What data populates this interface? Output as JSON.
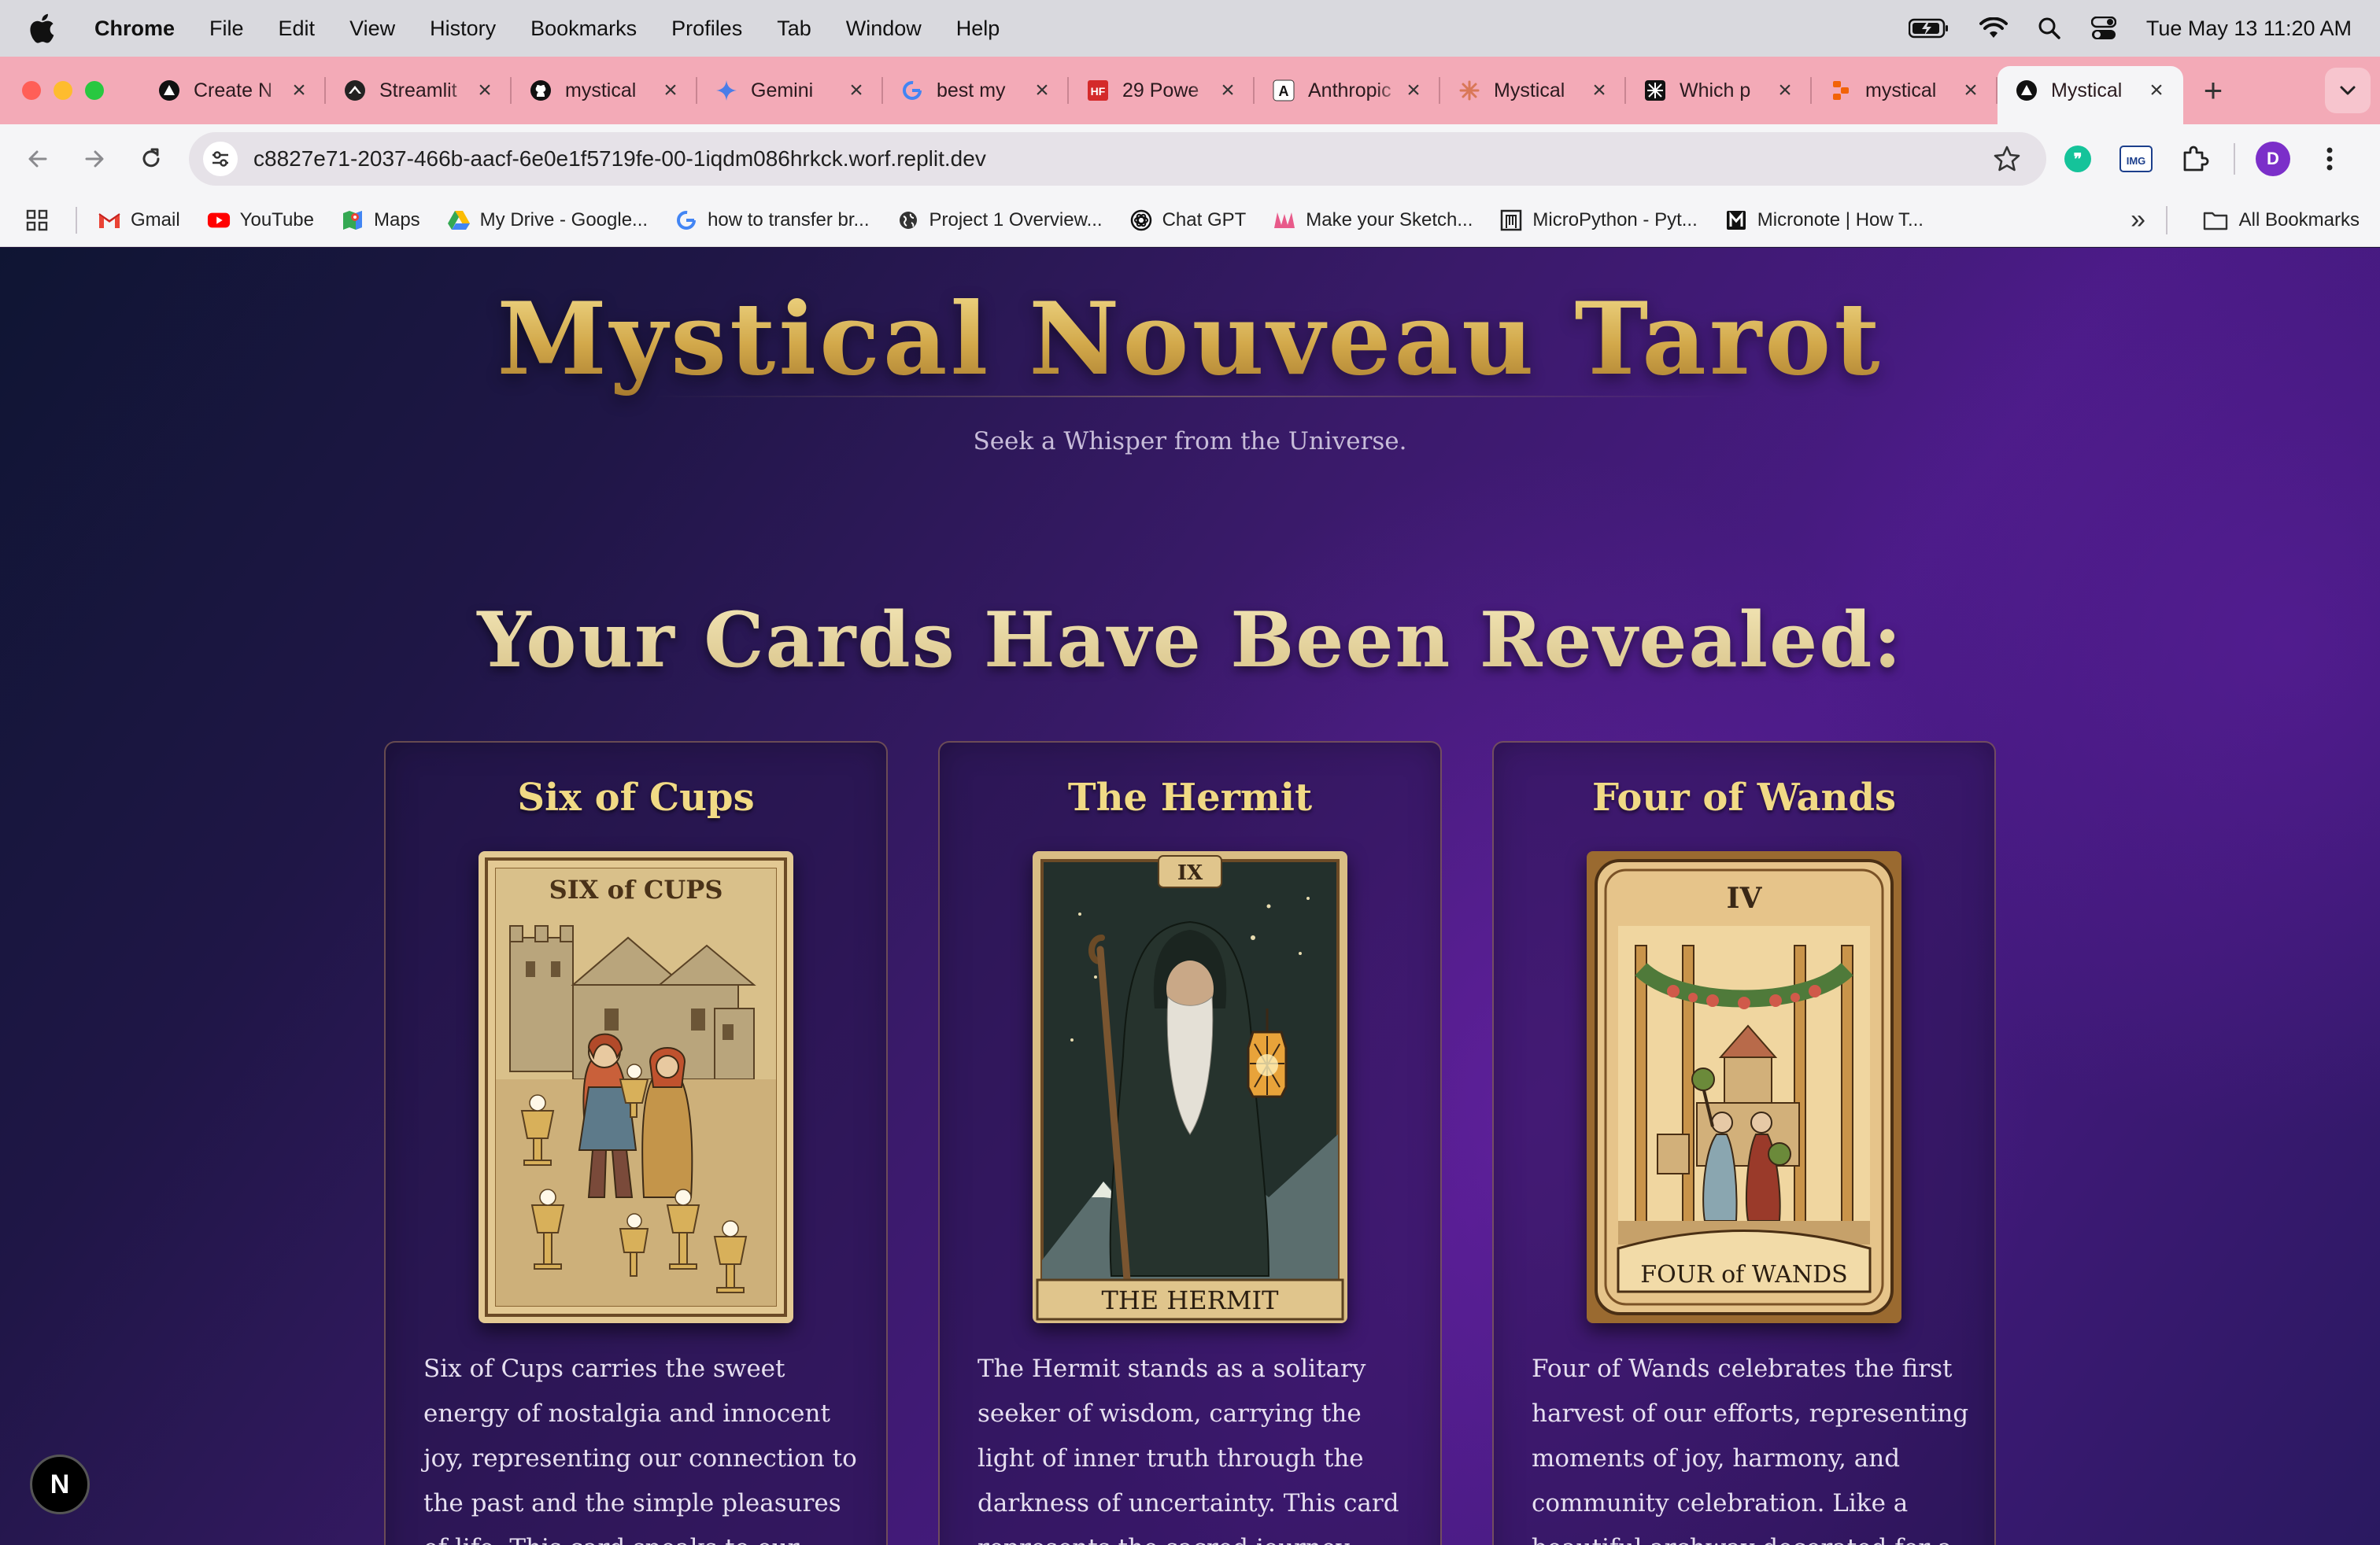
{
  "menubar": {
    "app_name": "Chrome",
    "items": [
      "File",
      "Edit",
      "View",
      "History",
      "Bookmarks",
      "Profiles",
      "Tab",
      "Window",
      "Help"
    ],
    "clock": "Tue May 13  11:20 AM"
  },
  "tabs": [
    {
      "title": "Create N",
      "icon": "triangle-logo-icon"
    },
    {
      "title": "Streamlit",
      "icon": "streamlit-icon"
    },
    {
      "title": "mystical",
      "icon": "github-icon"
    },
    {
      "title": "Gemini",
      "icon": "gemini-sparkle-icon"
    },
    {
      "title": "best my",
      "icon": "google-icon"
    },
    {
      "title": "29 Powe",
      "icon": "hf-icon"
    },
    {
      "title": "Anthropic",
      "icon": "anthropic-icon"
    },
    {
      "title": "Mystical",
      "icon": "claude-icon"
    },
    {
      "title": "Which p",
      "icon": "grid-logo-icon"
    },
    {
      "title": "mystical",
      "icon": "replit-icon"
    },
    {
      "title": "Mystical",
      "icon": "triangle-logo-icon",
      "active": true
    }
  ],
  "address_bar": {
    "url": "c8827e71-2037-466b-aacf-6e0e1f5719fe-00-1iqdm086hrkck.worf.replit.dev"
  },
  "extensions": {
    "ext2_label": "IMG",
    "avatar_letter": "D"
  },
  "bookmarks": [
    {
      "label": "Gmail",
      "icon": "gmail-icon"
    },
    {
      "label": "YouTube",
      "icon": "youtube-icon"
    },
    {
      "label": "Maps",
      "icon": "maps-icon"
    },
    {
      "label": "My Drive - Google...",
      "icon": "drive-icon"
    },
    {
      "label": "how to transfer br...",
      "icon": "google-icon"
    },
    {
      "label": "Project 1 Overview...",
      "icon": "globe-icon"
    },
    {
      "label": "Chat GPT",
      "icon": "openai-icon"
    },
    {
      "label": "Make your Sketch...",
      "icon": "sketch-icon"
    },
    {
      "label": "MicroPython - Pyt...",
      "icon": "micropython-icon"
    },
    {
      "label": "Micronote | How T...",
      "icon": "micronote-icon"
    }
  ],
  "bookmarks_all": "All Bookmarks",
  "page": {
    "title": "Mystical Nouveau Tarot",
    "subtitle": "Seek a Whisper from the Universe.",
    "heading": "Your Cards Have Been Revealed:",
    "cards": [
      {
        "name": "Six of Cups",
        "art_label_top": "SIX of CUPS",
        "description": "Six of Cups carries the sweet energy of nostalgia and innocent joy, representing our connection to the past and the simple pleasures of life. This card speaks to our capacity for"
      },
      {
        "name": "The Hermit",
        "art_label_top": "IX",
        "art_label_bottom": "THE HERMIT",
        "description": "The Hermit stands as a solitary seeker of wisdom, carrying the light of inner truth through the darkness of uncertainty. This card represents the sacred journey inward, the quest for"
      },
      {
        "name": "Four of Wands",
        "art_label_top": "IV",
        "art_label_bottom": "FOUR of WANDS",
        "description": "Four of Wands celebrates the first harvest of our efforts, representing moments of joy, harmony, and community celebration. Like a beautiful archway decorated for a"
      }
    ],
    "badge_letter": "N"
  },
  "colors": {
    "gold": "#d9b55a",
    "card_title": "#f1da85",
    "tab_strip": "#f3aab7"
  }
}
